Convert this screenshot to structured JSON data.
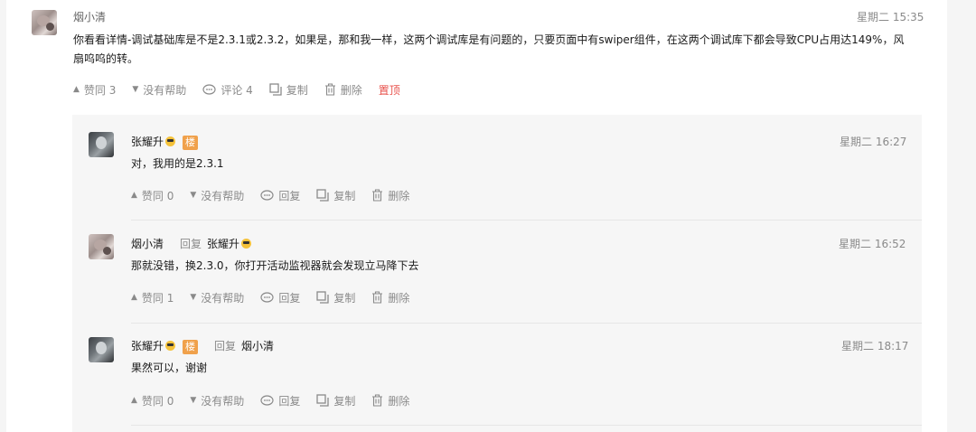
{
  "main_comment": {
    "author": "烟小清",
    "time": "星期二 15:35",
    "text": "你看看详情-调试基础库是不是2.3.1或2.3.2，如果是，那和我一样，这两个调试库是有问题的，只要页面中有swiper组件，在这两个调试库下都会导致CPU占用达149%，风扇呜呜的转。",
    "actions": {
      "like": "赞同 3",
      "unhelpful": "没有帮助",
      "comments": "评论 4",
      "copy": "复制",
      "delete": "删除",
      "pin": "置顶"
    }
  },
  "replies": [
    {
      "author": "张耀升",
      "tag": "楼",
      "reply_label": "",
      "reply_to": "",
      "time": "星期二 16:27",
      "text": "对，我用的是2.3.1",
      "actions": {
        "like": "赞同 0",
        "unhelpful": "没有帮助",
        "reply": "回复",
        "copy": "复制",
        "delete": "删除"
      }
    },
    {
      "author": "烟小清",
      "tag": "",
      "reply_label": "回复",
      "reply_to": "张耀升",
      "time": "星期二 16:52",
      "text": "那就没错，换2.3.0，你打开活动监视器就会发现立马降下去",
      "actions": {
        "like": "赞同 1",
        "unhelpful": "没有帮助",
        "reply": "回复",
        "copy": "复制",
        "delete": "删除"
      }
    },
    {
      "author": "张耀升",
      "tag": "楼",
      "reply_label": "回复",
      "reply_to": "烟小清",
      "time": "星期二 18:17",
      "text": "果然可以，谢谢",
      "actions": {
        "like": "赞同 0",
        "unhelpful": "没有帮助",
        "reply": "回复",
        "copy": "复制",
        "delete": "删除"
      }
    }
  ],
  "icons": {
    "like": "triangle-up-icon",
    "unhelpful": "triangle-down-icon",
    "comment": "chat-bubble-icon",
    "copy": "copy-icon",
    "delete": "trash-icon",
    "user_badge": "sunglasses-emoji-icon"
  },
  "colors": {
    "pin": "#e8524c",
    "tag": "#f0a14b",
    "muted": "#8a8a8a"
  }
}
